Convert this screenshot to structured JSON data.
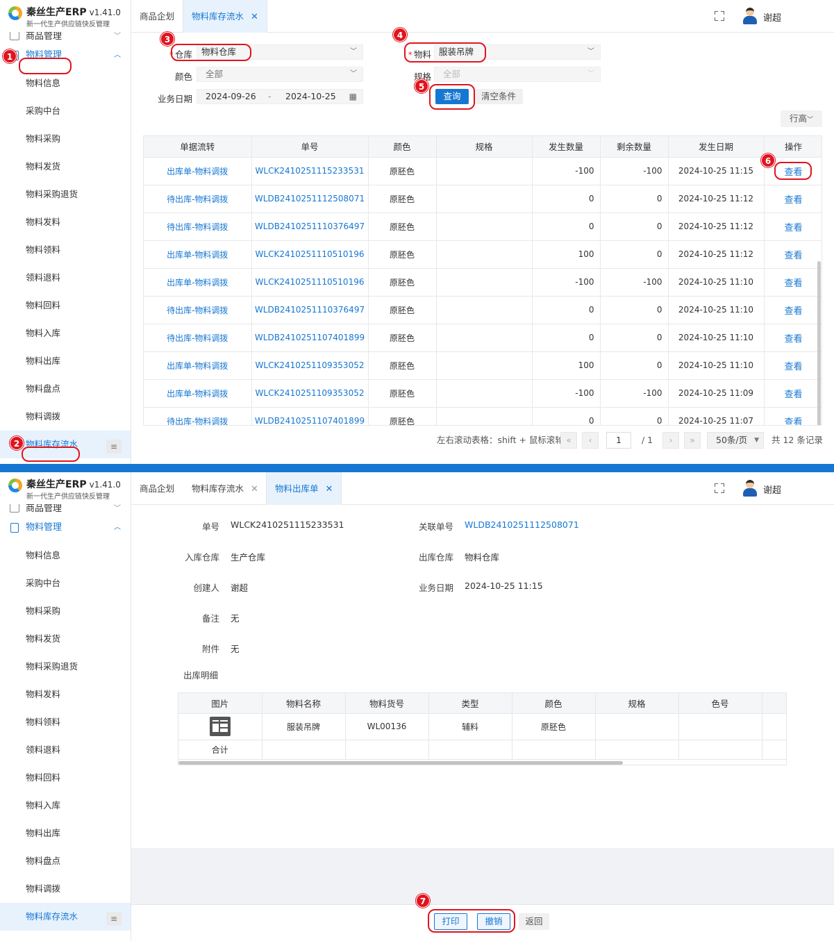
{
  "app": {
    "title": "秦丝生产ERP",
    "version": "v1.41.0",
    "subtitle": "新一代生产供应链快反管理",
    "user": "谢超"
  },
  "sidebar": {
    "top_item": "商品管理",
    "group": "物料管理",
    "items": [
      "物料信息",
      "采购中台",
      "物料采购",
      "物料发货",
      "物料采购退货",
      "物料发料",
      "物料领料",
      "领料退料",
      "物料回料",
      "物料入库",
      "物料出库",
      "物料盘点",
      "物料调拨",
      "物料库存流水"
    ]
  },
  "screen1": {
    "tabs": [
      {
        "label": "商品企划"
      },
      {
        "label": "物料库存流水",
        "close": "✕"
      }
    ],
    "filters": {
      "warehouse_label": "仓库",
      "warehouse_value": "物料仓库",
      "color_label": "颜色",
      "color_value": "全部",
      "date_label": "业务日期",
      "date_from": "2024-09-26",
      "date_sep": "-",
      "date_to": "2024-10-25",
      "material_label": "物料",
      "material_value": "服装吊牌",
      "spec_label": "规格",
      "spec_value": "全部",
      "required_mark": "*"
    },
    "buttons": {
      "query": "查询",
      "clear": "清空条件",
      "row_height": "行高"
    },
    "table": {
      "columns": [
        "单据流转",
        "单号",
        "颜色",
        "规格",
        "发生数量",
        "剩余数量",
        "发生日期",
        "操作"
      ],
      "rows": [
        [
          "出库单-物料调拨",
          "WLCK2410251115233531",
          "原胚色",
          "",
          "-100",
          "-100",
          "2024-10-25 11:15",
          "查看"
        ],
        [
          "待出库-物料调拨",
          "WLDB2410251112508071",
          "原胚色",
          "",
          "0",
          "0",
          "2024-10-25 11:12",
          "查看"
        ],
        [
          "待出库-物料调拨",
          "WLDB2410251110376497",
          "原胚色",
          "",
          "0",
          "0",
          "2024-10-25 11:12",
          "查看"
        ],
        [
          "出库单-物料调拨",
          "WLCK2410251110510196",
          "原胚色",
          "",
          "100",
          "0",
          "2024-10-25 11:12",
          "查看"
        ],
        [
          "出库单-物料调拨",
          "WLCK2410251110510196",
          "原胚色",
          "",
          "-100",
          "-100",
          "2024-10-25 11:10",
          "查看"
        ],
        [
          "待出库-物料调拨",
          "WLDB2410251110376497",
          "原胚色",
          "",
          "0",
          "0",
          "2024-10-25 11:10",
          "查看"
        ],
        [
          "待出库-物料调拨",
          "WLDB2410251107401899",
          "原胚色",
          "",
          "0",
          "0",
          "2024-10-25 11:10",
          "查看"
        ],
        [
          "出库单-物料调拨",
          "WLCK2410251109353052",
          "原胚色",
          "",
          "100",
          "0",
          "2024-10-25 11:10",
          "查看"
        ],
        [
          "出库单-物料调拨",
          "WLCK2410251109353052",
          "原胚色",
          "",
          "-100",
          "-100",
          "2024-10-25 11:09",
          "查看"
        ],
        [
          "待出库-物料调拨",
          "WLDB2410251107401899",
          "原胚色",
          "",
          "0",
          "0",
          "2024-10-25 11:07",
          "查看"
        ]
      ]
    },
    "pager": {
      "hint": "左右滚动表格：shift + 鼠标滚轮",
      "page": "1",
      "total_pages": "/ 1",
      "page_size": "50条/页",
      "total": "共 12 条记录"
    }
  },
  "screen2": {
    "tabs": [
      {
        "label": "商品企划"
      },
      {
        "label": "物料库存流水",
        "close": "✕"
      },
      {
        "label": "物料出库单",
        "close": "✕"
      }
    ],
    "detail": {
      "order_no_label": "单号",
      "order_no": "WLCK2410251115233531",
      "related_label": "关联单号",
      "related_no": "WLDB2410251112508071",
      "in_wh_label": "入库仓库",
      "in_wh": "生产仓库",
      "out_wh_label": "出库仓库",
      "out_wh": "物料仓库",
      "creator_label": "创建人",
      "creator": "谢超",
      "date_label": "业务日期",
      "date": "2024-10-25 11:15",
      "remark_label": "备注",
      "remark": "无",
      "attach_label": "附件",
      "attach": "无",
      "section_title": "出库明细"
    },
    "sub_table": {
      "columns": [
        "图片",
        "物料名称",
        "物料货号",
        "类型",
        "颜色",
        "规格",
        "色号"
      ],
      "row": [
        "",
        "服装吊牌",
        "WL00136",
        "辅料",
        "原胚色",
        "",
        ""
      ],
      "sum_label": "合计"
    },
    "buttons": {
      "print": "打印",
      "revoke": "撤销",
      "back": "返回"
    }
  },
  "annotations": [
    "1",
    "2",
    "3",
    "4",
    "5",
    "6",
    "7"
  ],
  "colors": {
    "primary": "#1677d2",
    "annotation": "#e0141e",
    "divider": "#1677d2"
  }
}
